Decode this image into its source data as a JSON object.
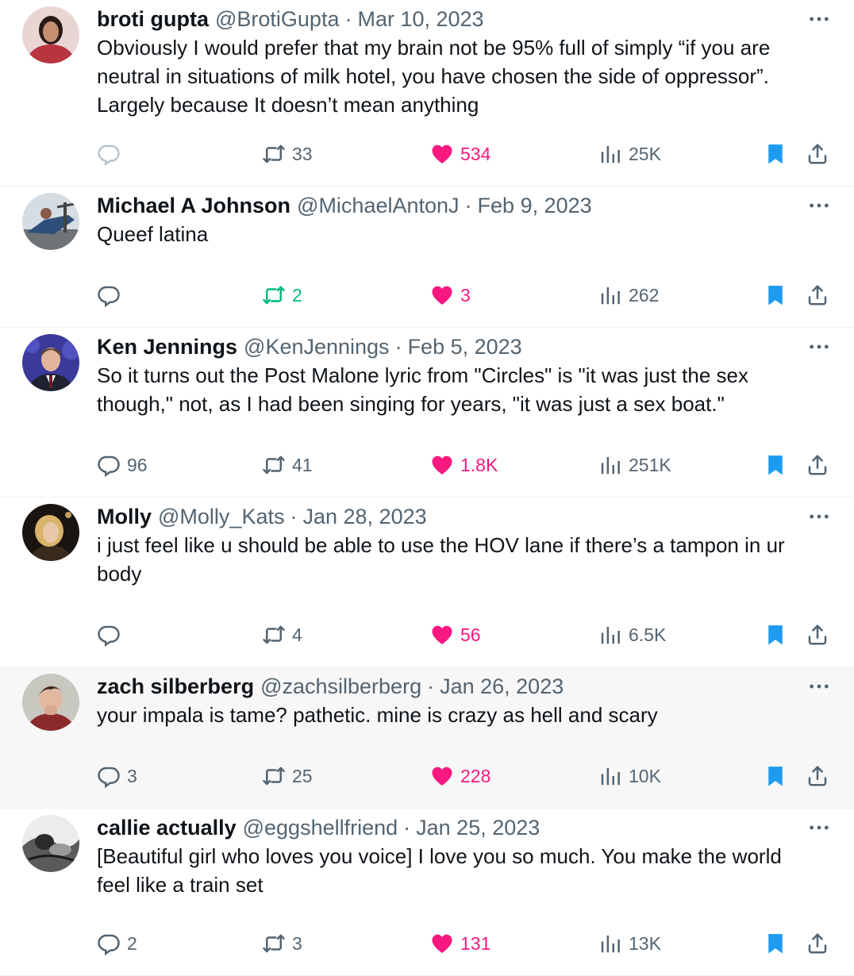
{
  "colors": {
    "like_pink": "#f91880",
    "retweet_green": "#00ba7c",
    "bookmark_blue": "#1d9bf0",
    "meta_gray": "#536471",
    "reply_faded": "#b8c3cc"
  },
  "icons": {
    "reply": "reply-icon",
    "retweet": "retweet-icon",
    "like": "heart-icon",
    "views": "views-icon",
    "bookmark": "bookmark-icon",
    "share": "share-icon",
    "more": "more-icon"
  },
  "tweets": [
    {
      "name": "broti gupta",
      "handle": "@BrotiGupta",
      "date": "Mar 10, 2023",
      "text": "Obviously I would prefer that my brain not be 95% full of simply “if you are neutral in situations of milk hotel, you have chosen the side of oppressor”. Largely because It doesn’t mean anything",
      "replies": "",
      "retweets": "33",
      "likes": "534",
      "views": "25K",
      "liked": true,
      "retweeted": false,
      "bookmarked": true,
      "reply_faded": true
    },
    {
      "name": "Michael A Johnson",
      "handle": "@MichaelAntonJ",
      "date": "Feb 9, 2023",
      "text": "Queef latina",
      "replies": "",
      "retweets": "2",
      "likes": "3",
      "views": "262",
      "liked": true,
      "retweeted": true,
      "bookmarked": true
    },
    {
      "name": "Ken Jennings",
      "handle": "@KenJennings",
      "date": "Feb 5, 2023",
      "text": "So it turns out the Post Malone lyric from \"Circles\" is \"it was just the sex though,\" not, as I had been singing for years, \"it was just a sex boat.\"",
      "replies": "96",
      "retweets": "41",
      "likes": "1.8K",
      "views": "251K",
      "liked": true,
      "retweeted": false,
      "bookmarked": true
    },
    {
      "name": "Molly",
      "handle": "@Molly_Kats",
      "date": "Jan 28, 2023",
      "text": "i just feel like u should be able to use the HOV lane if there’s a tampon in ur body",
      "replies": "",
      "retweets": "4",
      "likes": "56",
      "views": "6.5K",
      "liked": true,
      "retweeted": false,
      "bookmarked": true
    },
    {
      "name": "zach silberberg",
      "handle": "@zachsilberberg",
      "date": "Jan 26, 2023",
      "text": "your impala is tame? pathetic. mine is crazy as hell and scary",
      "replies": "3",
      "retweets": "25",
      "likes": "228",
      "views": "10K",
      "liked": true,
      "retweeted": false,
      "bookmarked": true,
      "hovered": true
    },
    {
      "name": "callie actually",
      "handle": "@eggshellfriend",
      "date": "Jan 25, 2023",
      "text": "[Beautiful girl who loves you voice] I love you so much. You make the world feel like a train set",
      "replies": "2",
      "retweets": "3",
      "likes": "131",
      "views": "13K",
      "liked": true,
      "retweeted": false,
      "bookmarked": true
    }
  ]
}
